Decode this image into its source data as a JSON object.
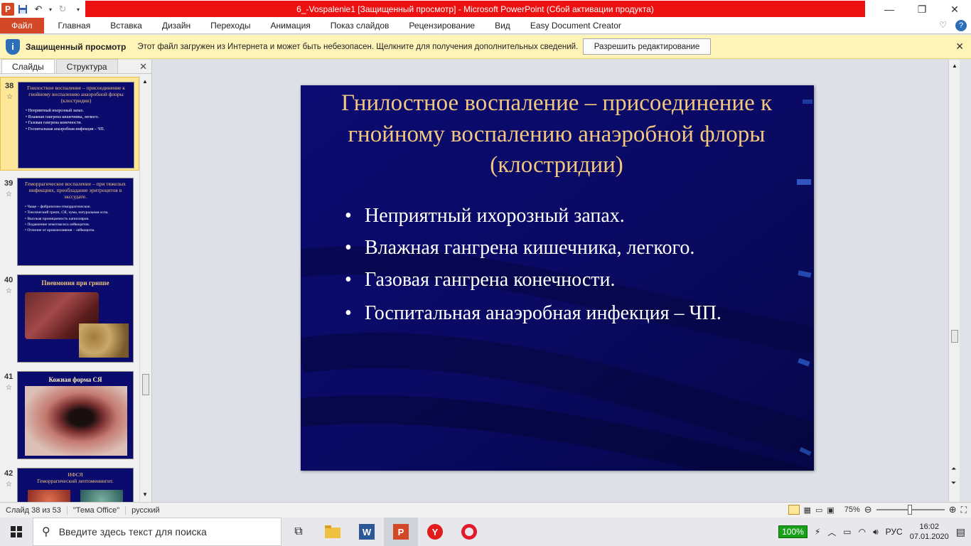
{
  "window": {
    "title": "6_-Vospalenie1 [Защищенный просмотр]  -  Microsoft PowerPoint (Сбой активации продукта)"
  },
  "ribbon": {
    "tabs": [
      "Файл",
      "Главная",
      "Вставка",
      "Дизайн",
      "Переходы",
      "Анимация",
      "Показ слайдов",
      "Рецензирование",
      "Вид",
      "Easy Document Creator"
    ]
  },
  "protected_view": {
    "title": "Защищенный просмотр",
    "message": "Этот файл загружен из Интернета и может быть небезопасен. Щелкните для получения дополнительных сведений.",
    "button": "Разрешить редактирование"
  },
  "left_panel": {
    "tabs": [
      "Слайды",
      "Структура"
    ],
    "thumbnails": [
      {
        "num": "38",
        "title": "Гнилостное воспаление – присоединение к гнойному воспалению анаэробной флоры (клостридии)",
        "bullets": [
          "Неприятный ихорозный запах.",
          "Влажная гангрена кишечника, легкого.",
          "Газовая гангрена конечности.",
          "Госпитальная анаэробная инфекция – ЧП."
        ]
      },
      {
        "num": "39",
        "title": "Геморрагическое воспаление – при тяжелых инфекциях, преобладание эритроцитов в экссудате.",
        "bullets": [
          "Чаще – фибринозно-геморрагическое.",
          "Токсический грипп, СЯ, чума, натуральная оспа.",
          "Высокая проницаемость капилляров.",
          "Подавление хемотаксиса лейкоцитов.",
          "Отличие от кровоизлияния – лейкоциты."
        ]
      },
      {
        "num": "40",
        "title": "Пневмония при гриппе"
      },
      {
        "num": "41",
        "title": "Кожная форма СЯ"
      },
      {
        "num": "42",
        "title": "ИФСЯ",
        "subtitle": "Геморрагический лептоменингит."
      }
    ]
  },
  "slide": {
    "title": "Гнилостное воспаление – присоединение к гнойному воспалению анаэробной флоры (клостридии)",
    "bullets": [
      "Неприятный ихорозный запах.",
      "Влажная гангрена кишечника, легкого.",
      "Газовая гангрена конечности.",
      "Госпитальная анаэробная инфекция – ЧП."
    ]
  },
  "status": {
    "slide_info": "Слайд 38 из 53",
    "theme": "\"Тема Office\"",
    "language": "русский",
    "zoom": "75%"
  },
  "taskbar": {
    "search_placeholder": "Введите здесь текст для поиска",
    "battery": "100%",
    "lang": "РУС",
    "time": "16:02",
    "date": "07.01.2020"
  },
  "colors": {
    "accent": "#d24726",
    "title_bar_red": "#ee1111",
    "slide_bg": "#0a0a6a",
    "slide_title": "#f3c77e",
    "infobar": "#fff4b8"
  }
}
